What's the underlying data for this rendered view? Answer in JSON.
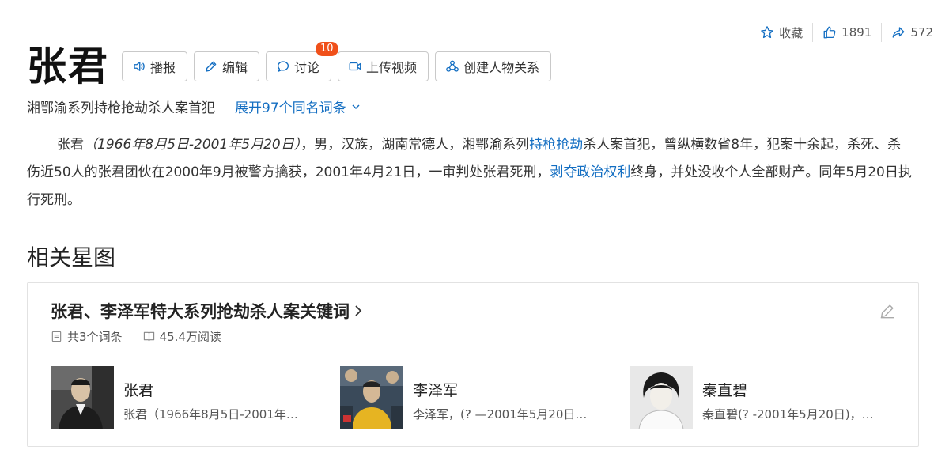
{
  "header": {
    "favorite_label": "收藏",
    "like_count": "1891",
    "share_count": "572"
  },
  "title": "张君",
  "buttons": {
    "broadcast": "播报",
    "edit": "编辑",
    "discuss": "讨论",
    "discuss_badge": "10",
    "upload_video": "上传视频",
    "create_relation": "创建人物关系"
  },
  "subtitle": "湘鄂渝系列持枪抢劫杀人案首犯",
  "expand_label": "展开97个同名词条",
  "summary": {
    "name": "张君",
    "dates": "（1966年8月5日-2001年5月20日）",
    "part1": "，男，汉族，湖南常德人，湘鄂渝系列",
    "link1": "持枪抢劫",
    "part2": "杀人案首犯，曾纵横数省8年，犯案十余起，杀死、杀伤近50人的张君团伙在2000年9月被警方擒获，2001年4月21日，一审判处张君死刑，",
    "link2": "剥夺政治权利",
    "part3": "终身，并处没收个人全部财产。同年5月20日执行死刑。"
  },
  "section_title": "相关星图",
  "card": {
    "title": "张君、李泽军特大系列抢劫杀人案关键词",
    "entry_count": "共3个词条",
    "reads": "45.4万阅读",
    "entries": [
      {
        "name": "张君",
        "desc": "张君（1966年8月5日-2001年…"
      },
      {
        "name": "李泽军",
        "desc": "李泽军，(? —2001年5月20日…"
      },
      {
        "name": "秦直碧",
        "desc": "秦直碧(? -2001年5月20日)，…"
      }
    ]
  },
  "colors": {
    "link": "#136ec2",
    "badge": "#f0501a"
  }
}
